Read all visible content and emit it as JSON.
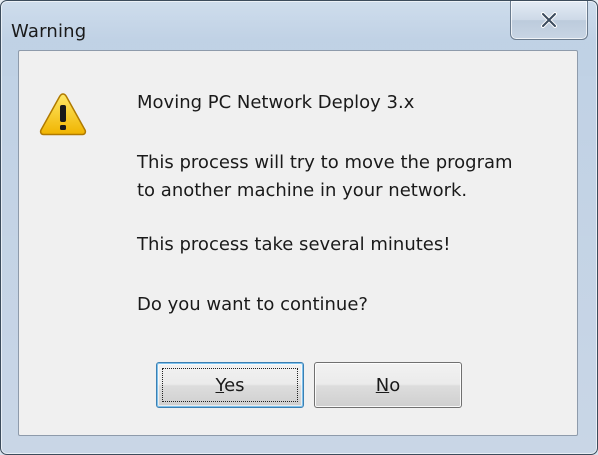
{
  "window": {
    "title": "Warning"
  },
  "icons": {
    "close": "close-icon",
    "warning": "warning-icon"
  },
  "message": {
    "heading": "Moving PC Network Deploy 3.x",
    "line1": "This process will try to move the program",
    "line2": "to another machine in your network.",
    "line3": "This process take several minutes!",
    "question": "Do you want to continue?"
  },
  "buttons": {
    "yes": {
      "mnemonic": "Y",
      "rest": "es"
    },
    "no": {
      "mnemonic": "N",
      "rest": "o"
    }
  },
  "colors": {
    "warning_yellow": "#f5c400",
    "default_button_border": "#3c7fb1"
  }
}
